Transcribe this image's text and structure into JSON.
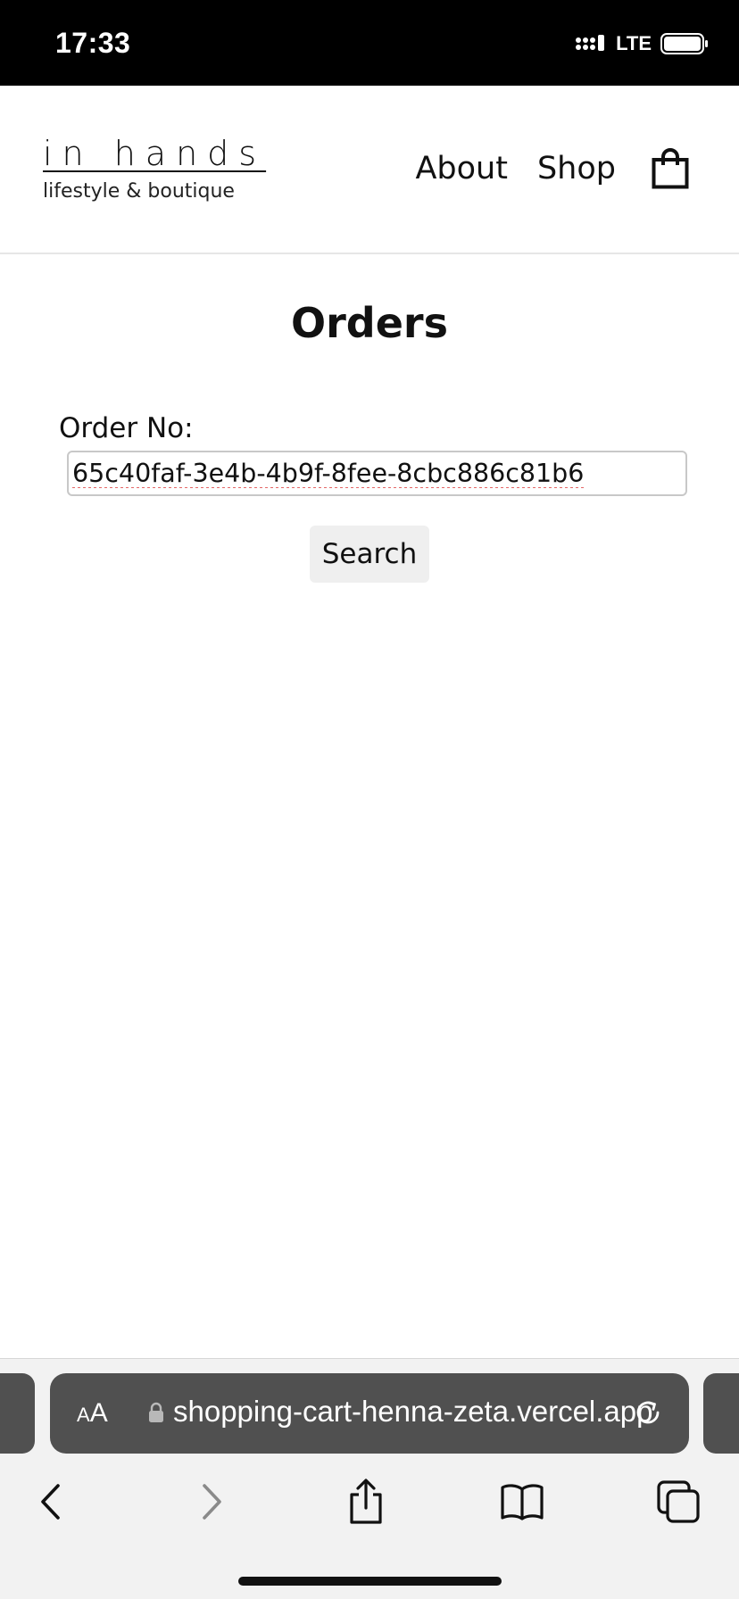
{
  "status_bar": {
    "time": "17:33",
    "network": "LTE",
    "icons": [
      "signal-icon",
      "battery-icon"
    ]
  },
  "header": {
    "logo_title": "in hands",
    "logo_subtitle": "lifestyle & boutique",
    "nav": [
      {
        "label": "About"
      },
      {
        "label": "Shop"
      }
    ],
    "cart_icon": "shopping-bag-icon"
  },
  "main": {
    "title": "Orders",
    "order_label": "Order No:",
    "order_value": "65c40faf-3e4b-4b9f-8fee-8cbc886c81b6",
    "search_label": "Search"
  },
  "browser": {
    "reader_label_small": "A",
    "reader_label_large": "A",
    "url": "shopping-cart-henna-zeta.vercel.app",
    "icons": [
      "lock-icon",
      "reload-icon",
      "back-icon",
      "forward-icon",
      "share-icon",
      "bookmarks-icon",
      "tabs-icon"
    ],
    "forward_enabled": false
  }
}
